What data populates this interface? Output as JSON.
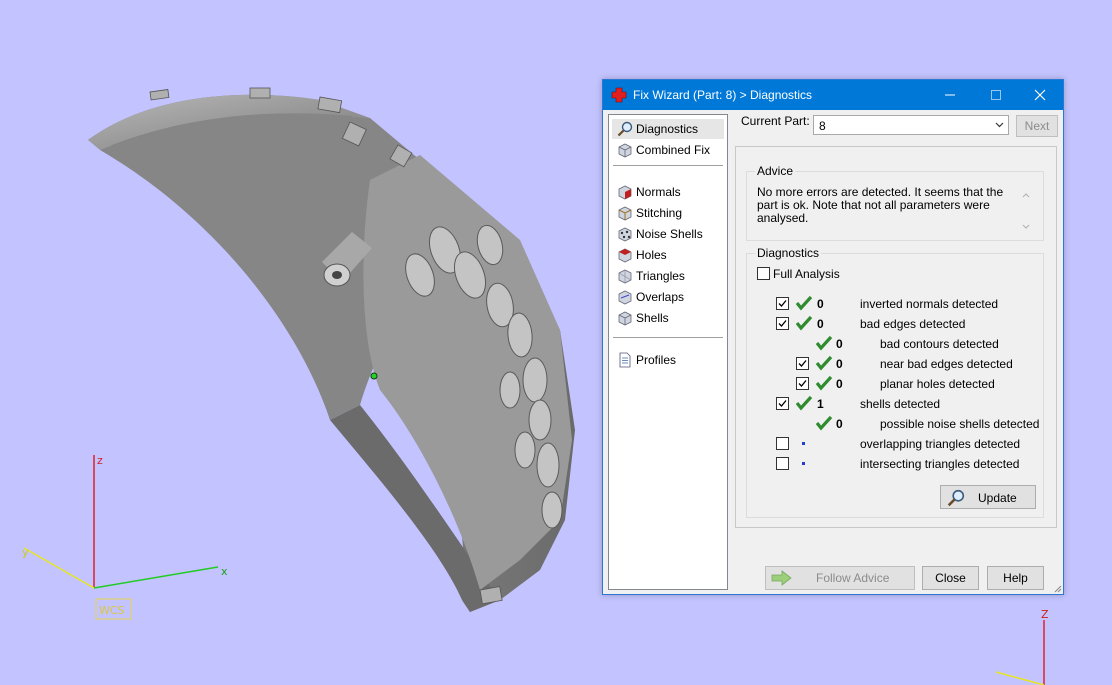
{
  "viewport": {
    "wcs_label": "WCS",
    "axis_x": "x",
    "axis_y": "y",
    "axis_z": "z",
    "axis_z2": "Z"
  },
  "dialog": {
    "title": "Fix Wizard (Part: 8) > Diagnostics",
    "nav": [
      {
        "label": "Diagnostics",
        "icon": "magnifier-icon"
      },
      {
        "label": "Combined Fix",
        "icon": "cube-icon"
      },
      {
        "label": "Normals",
        "icon": "normals-cube-icon"
      },
      {
        "label": "Stitching",
        "icon": "stitching-cube-icon"
      },
      {
        "label": "Noise Shells",
        "icon": "noise-shells-icon"
      },
      {
        "label": "Holes",
        "icon": "holes-cube-icon"
      },
      {
        "label": "Triangles",
        "icon": "triangles-cube-icon"
      },
      {
        "label": "Overlaps",
        "icon": "overlaps-cube-icon"
      },
      {
        "label": "Shells",
        "icon": "shells-cube-icon"
      },
      {
        "label": "Profiles",
        "icon": "document-icon"
      }
    ],
    "current_part_label": "Current Part:",
    "current_part_value": "8",
    "next_label": "Next",
    "advice": {
      "title": "Advice",
      "text": "No more errors are detected. It seems that the part is ok. Note that not all parameters were analysed."
    },
    "diagnostics": {
      "title": "Diagnostics",
      "full_analysis_label": "Full Analysis",
      "rows": [
        {
          "label": "inverted normals detected",
          "count": "0"
        },
        {
          "label": "bad edges detected",
          "count": "0"
        },
        {
          "label": "bad contours detected",
          "count": "0"
        },
        {
          "label": "near bad edges detected",
          "count": "0"
        },
        {
          "label": "planar holes detected",
          "count": "0"
        },
        {
          "label": "shells detected",
          "count": "1"
        },
        {
          "label": "possible noise shells detected",
          "count": "0"
        },
        {
          "label": "overlapping triangles detected",
          "count": ""
        },
        {
          "label": "intersecting triangles detected",
          "count": ""
        }
      ]
    },
    "update_label": "Update",
    "follow_advice_label": "Follow Advice",
    "close_label": "Close",
    "help_label": "Help",
    "colors": {
      "titlebar": "#0078d7",
      "check": "#2e8b2e",
      "background": "#c3c3ff"
    }
  }
}
